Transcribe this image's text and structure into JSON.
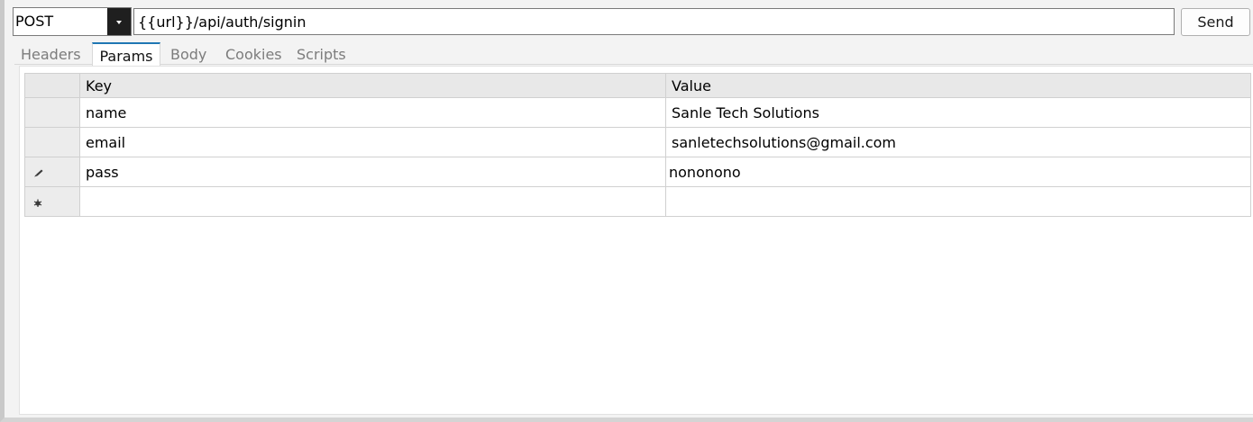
{
  "request": {
    "method": "POST",
    "url": "{{url}}/api/auth/signin",
    "send_label": "Send"
  },
  "tabs": [
    {
      "label": "Headers",
      "active": false
    },
    {
      "label": "Params",
      "active": true
    },
    {
      "label": "Body",
      "active": false
    },
    {
      "label": "Cookies",
      "active": false
    },
    {
      "label": "Scripts",
      "active": false
    }
  ],
  "params": {
    "columns": [
      "Key",
      "Value"
    ],
    "rows": [
      {
        "key": "name",
        "value": "Sanle Tech Solutions",
        "indicator": "none"
      },
      {
        "key": "email",
        "value": "sanletechsolutions@gmail.com",
        "indicator": "none"
      },
      {
        "key": "pass",
        "value": "nononono",
        "indicator": "pencil-icon"
      },
      {
        "key": "",
        "value": "",
        "indicator": "new-row-icon"
      }
    ]
  },
  "colors": {
    "accent_tab": "#1f77b4",
    "dropdown_dark": "#1f1f1f",
    "grid_header": "#e8e8e8"
  }
}
